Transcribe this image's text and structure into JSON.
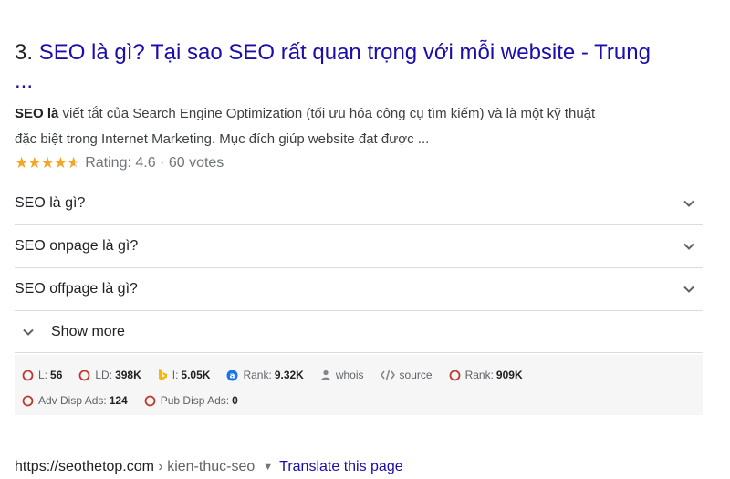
{
  "result": {
    "number": "3.",
    "title_line1": "SEO là gì? Tại sao SEO rất quan trọng với mỗi website - Trung",
    "title_line2": "...",
    "snippet_bold": "SEO là",
    "snippet_line1": " viết tắt của Search Engine Optimization (tối ưu hóa công cụ tìm kiếm) và là một kỹ thuật",
    "snippet_line2": "đặc biệt trong Internet Marketing. Mục đích giúp website đạt được ...",
    "rating_stars": 4.6,
    "rating_text": "Rating: 4.6 · 60 votes"
  },
  "faq": [
    {
      "question": "SEO là gì?"
    },
    {
      "question": "SEO onpage là gì?"
    },
    {
      "question": "SEO offpage là gì?"
    }
  ],
  "show_more_label": "Show more",
  "seo_metrics": {
    "line1": [
      {
        "label": "L:",
        "value": "56",
        "icon": "circle-icon"
      },
      {
        "label": "LD:",
        "value": "398K",
        "icon": "circle-icon"
      },
      {
        "label": "I:",
        "value": "5.05K",
        "icon": "bing-icon"
      },
      {
        "label": "Rank:",
        "value": "9.32K",
        "icon": "alexa-icon"
      },
      {
        "label": "whois",
        "value": "",
        "icon": "person-icon"
      },
      {
        "label": "source",
        "value": "",
        "icon": "code-icon"
      },
      {
        "label": "Rank:",
        "value": "909K",
        "icon": "circle-icon"
      }
    ],
    "line2": [
      {
        "label": "Adv Disp Ads:",
        "value": "124",
        "icon": "circle-icon"
      },
      {
        "label": "Pub Disp Ads:",
        "value": "0",
        "icon": "circle-icon"
      }
    ]
  },
  "cite": {
    "url": "https://seothetop.com",
    "separator": " › ",
    "path": "kien-thuc-seo",
    "caret": "▼",
    "translate": "Translate this page"
  },
  "colors": {
    "link": "#1a0dab",
    "star": "#f5a623",
    "metric_icon": "#c0392b",
    "bing": "#f7b600",
    "alexa": "#1a73e8"
  }
}
